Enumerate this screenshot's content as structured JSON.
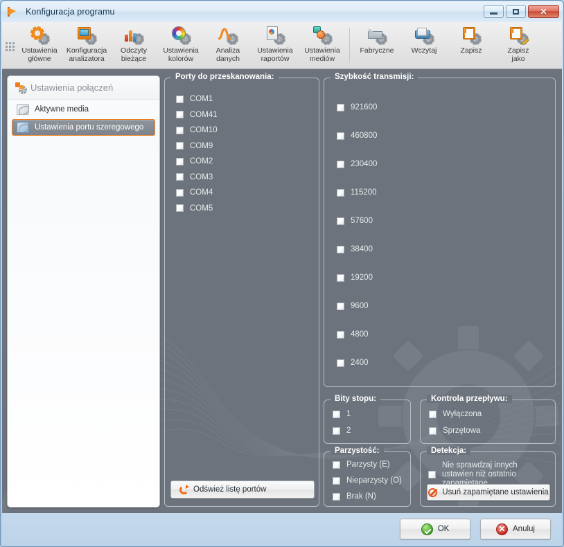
{
  "window": {
    "title": "Konfiguracja programu",
    "icon": "flag-icon",
    "controls": {
      "minimize": "minimize-icon",
      "maximize": "maximize-icon",
      "close": "close-icon"
    }
  },
  "toolbar": {
    "grip": "drag-grip",
    "items": [
      {
        "label_line1": "Ustawienia",
        "label_line2": "główne",
        "icon": "settings-gear-icon"
      },
      {
        "label_line1": "Konfiguracja",
        "label_line2": "analizatora",
        "icon": "analyzer-icon"
      },
      {
        "label_line1": "Odczyty",
        "label_line2": "bieżące",
        "icon": "bar-chart-icon"
      },
      {
        "label_line1": "Ustawienia",
        "label_line2": "kolorów",
        "icon": "color-wheel-icon"
      },
      {
        "label_line1": "Analiza",
        "label_line2": "danych",
        "icon": "waveform-icon"
      },
      {
        "label_line1": "Ustawienia",
        "label_line2": "raportów",
        "icon": "report-icon"
      },
      {
        "label_line1": "Ustawienia",
        "label_line2": "mediów",
        "icon": "media-icon"
      },
      {
        "label_line1": "Fabryczne",
        "label_line2": "",
        "icon": "factory-reset-icon"
      },
      {
        "label_line1": "Wczytaj",
        "label_line2": "",
        "icon": "open-folder-icon"
      },
      {
        "label_line1": "Zapisz",
        "label_line2": "",
        "icon": "save-disk-icon"
      },
      {
        "label_line1": "Zapisz",
        "label_line2": "jako",
        "icon": "save-as-icon"
      }
    ]
  },
  "sidebar": {
    "title": "Ustawienia połączeń",
    "title_icon": "connection-settings-icon",
    "items": [
      {
        "label": "Aktywne media",
        "icon": "media-link-icon",
        "selected": false
      },
      {
        "label": "Ustawienia portu szeregowego",
        "icon": "serial-link-icon",
        "selected": true
      }
    ]
  },
  "ports_group": {
    "title": "Porty do przeskanowania:",
    "items": [
      {
        "label": "COM1",
        "checked": false
      },
      {
        "label": "COM41",
        "checked": false
      },
      {
        "label": "COM10",
        "checked": false
      },
      {
        "label": "COM9",
        "checked": false
      },
      {
        "label": "COM2",
        "checked": false
      },
      {
        "label": "COM3",
        "checked": false
      },
      {
        "label": "COM4",
        "checked": false
      },
      {
        "label": "COM5",
        "checked": false
      }
    ],
    "refresh_button": {
      "label": "Odśwież listę portów",
      "icon": "refresh-icon"
    }
  },
  "baud_group": {
    "title": "Szybkość transmisji:",
    "items": [
      {
        "label": "921600",
        "checked": false
      },
      {
        "label": "460800",
        "checked": false
      },
      {
        "label": "230400",
        "checked": false
      },
      {
        "label": "115200",
        "checked": false
      },
      {
        "label": "57600",
        "checked": false
      },
      {
        "label": "38400",
        "checked": false
      },
      {
        "label": "19200",
        "checked": false
      },
      {
        "label": "9600",
        "checked": false
      },
      {
        "label": "4800",
        "checked": false
      },
      {
        "label": "2400",
        "checked": false
      }
    ]
  },
  "stopbits_group": {
    "title": "Bity stopu:",
    "items": [
      {
        "label": "1",
        "checked": false
      },
      {
        "label": "2",
        "checked": false
      }
    ]
  },
  "flowcontrol_group": {
    "title": "Kontrola przepływu:",
    "items": [
      {
        "label": "Wyłączona",
        "checked": false
      },
      {
        "label": "Sprzętowa",
        "checked": false
      }
    ]
  },
  "parity_group": {
    "title": "Parzystość:",
    "items": [
      {
        "label": "Parzysty (E)",
        "checked": false
      },
      {
        "label": "Nieparzysty (O)",
        "checked": false
      },
      {
        "label": "Brak (N)",
        "checked": false
      }
    ]
  },
  "detection_group": {
    "title": "Detekcja:",
    "checkbox": {
      "line1": "Nie sprawdzaj innych",
      "line2": "ustawien niż ostatnio zapamiętane",
      "checked": false
    },
    "clear_button": {
      "label": "Usuń zapamiętane ustawienia",
      "icon": "forbidden-icon"
    }
  },
  "footer": {
    "ok_button": {
      "label": "OK",
      "icon": "check-circle-icon"
    },
    "cancel_button": {
      "label": "Anuluj",
      "icon": "cross-circle-icon"
    }
  },
  "colors": {
    "accent_orange": "#ef7c1b",
    "panel_gray": "#6c737c",
    "titlebar_blue": "#cfe1f1",
    "selection_border": "#ef7c1b"
  }
}
